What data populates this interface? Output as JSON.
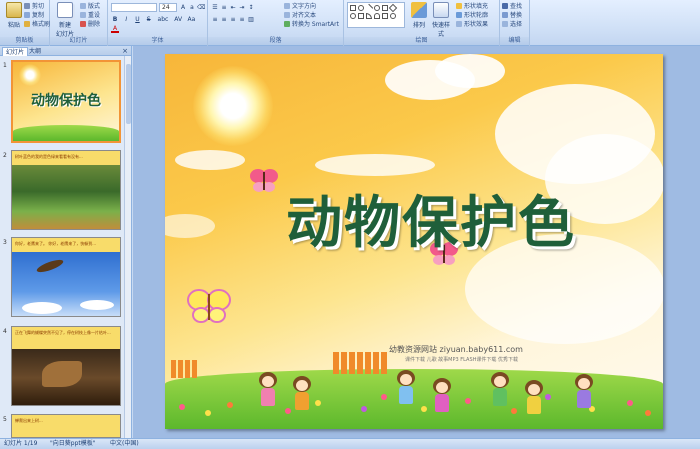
{
  "ribbon": {
    "clipboard": {
      "label": "剪贴板",
      "paste": "粘贴",
      "cut": "剪切",
      "copy": "复制",
      "format_painter": "格式刷"
    },
    "slides": {
      "label": "幻灯片",
      "new_slide": "新建\n幻灯片",
      "layout": "版式",
      "reset": "重设",
      "delete": "删除"
    },
    "font": {
      "label": "字体",
      "font_name": "",
      "font_size": "24",
      "bold": "B",
      "italic": "I",
      "underline": "U",
      "strike": "S",
      "shadow": "abc",
      "spacing": "AV",
      "case": "Aa",
      "color": "A"
    },
    "paragraph": {
      "label": "段落",
      "text_direction": "文字方向",
      "align_text": "对齐文本",
      "smartart": "转换为 SmartArt"
    },
    "drawing": {
      "label": "绘图",
      "arrange": "排列",
      "quick_styles": "快速样式",
      "shape_fill": "形状填充",
      "shape_outline": "形状轮廓",
      "shape_effects": "形状效果"
    },
    "editing": {
      "label": "编辑",
      "find": "查找",
      "replace": "替换",
      "select": "选择"
    }
  },
  "panel": {
    "tabs": [
      "幻灯片",
      "大纲"
    ],
    "close": "×",
    "thumbs": [
      {
        "num": "1",
        "title": "动物保护色"
      },
      {
        "num": "2",
        "caption": "树叶蓝色的我的是色绿来看看有没有..."
      },
      {
        "num": "3",
        "caption": "你好，老鹰来了。 你好，老鹰来了，快躲到..."
      },
      {
        "num": "4",
        "caption": "正在飞舞的蝴蝶突然不见了，停在树枝上像一片枯叶..."
      },
      {
        "num": "5",
        "caption": "蝉爬出来上树..."
      }
    ]
  },
  "slide": {
    "title": "动物保护色",
    "watermark": "幼教资源网站  ziyuan.baby611.com",
    "watermark_sub": "课件下载 儿歌 故事MP3 FLASH课件下载 优秀下载"
  },
  "status": {
    "slide_index": "幻灯片 1/19",
    "theme": "\"向日葵ppt模板\"",
    "language": "中文(中国)"
  },
  "colors": {
    "title_green": "#1f5f3a",
    "ribbon_blue": "#d1e1f7",
    "selected_thumb": "#f29436"
  }
}
